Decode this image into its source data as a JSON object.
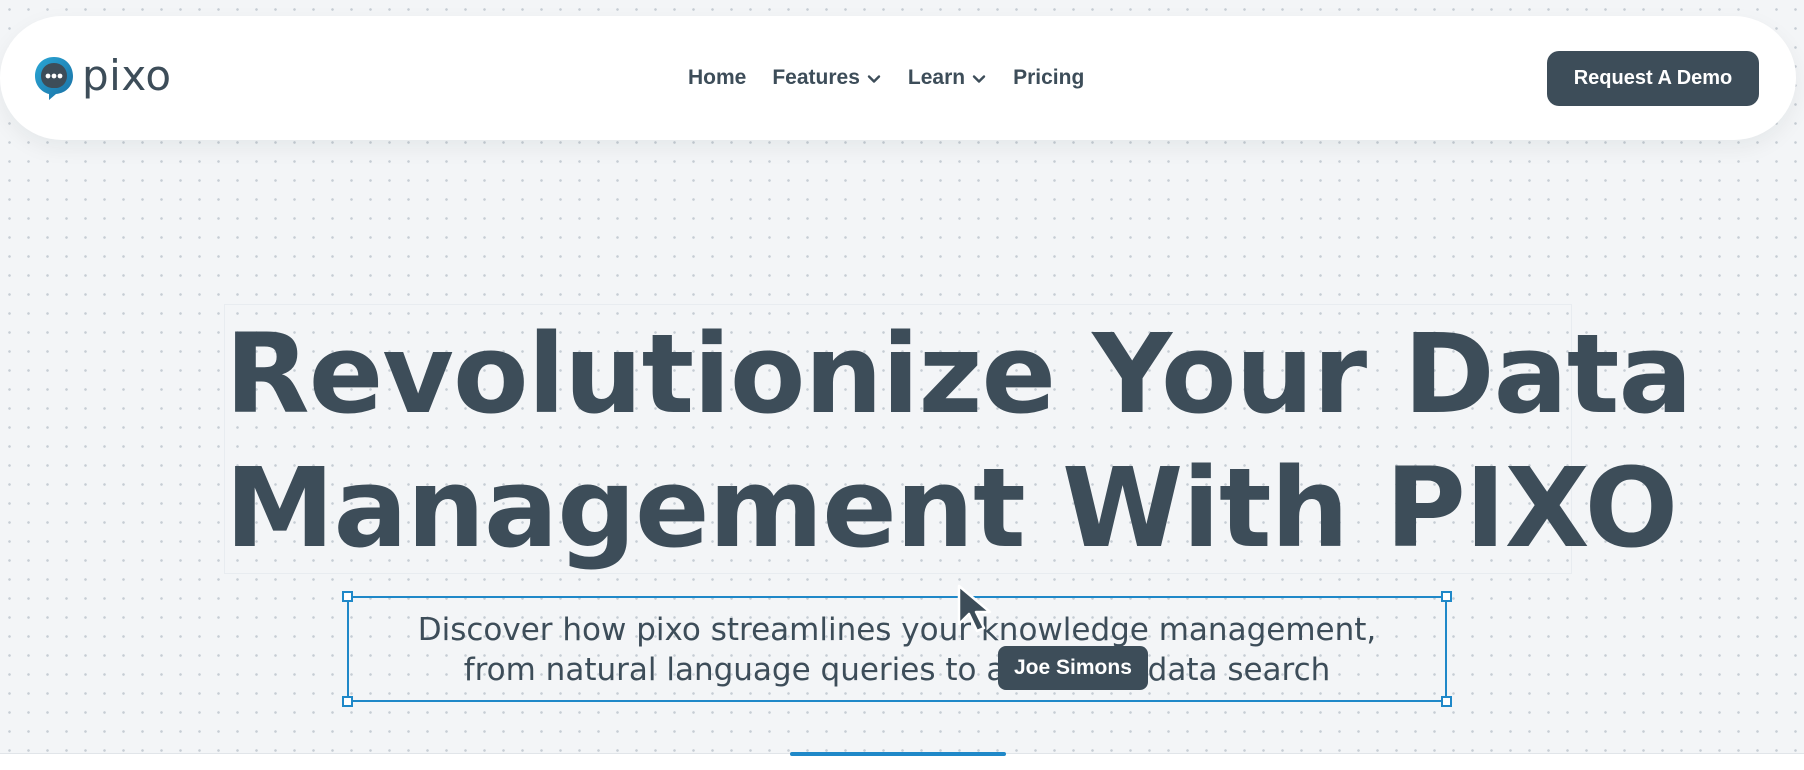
{
  "brand": {
    "name": "pixo",
    "logo_icon": "chat-bubble-icon",
    "accent_color": "#1f88c8",
    "primary_color": "#3d4d59"
  },
  "nav": {
    "links": [
      {
        "label": "Home",
        "has_dropdown": false
      },
      {
        "label": "Features",
        "has_dropdown": true
      },
      {
        "label": "Learn",
        "has_dropdown": true
      },
      {
        "label": "Pricing",
        "has_dropdown": false
      }
    ],
    "cta_label": "Request A Demo"
  },
  "hero": {
    "title_line1": "Revolutionize Your Data",
    "title_line2": "Management With PIXO",
    "subtitle_line1": "Discover how pixo streamlines your knowledge management,",
    "subtitle_line2": "from natural language queries to advanced data search"
  },
  "collaborator": {
    "name": "Joe Simons",
    "cursor_icon": "pointer-cursor-icon"
  }
}
